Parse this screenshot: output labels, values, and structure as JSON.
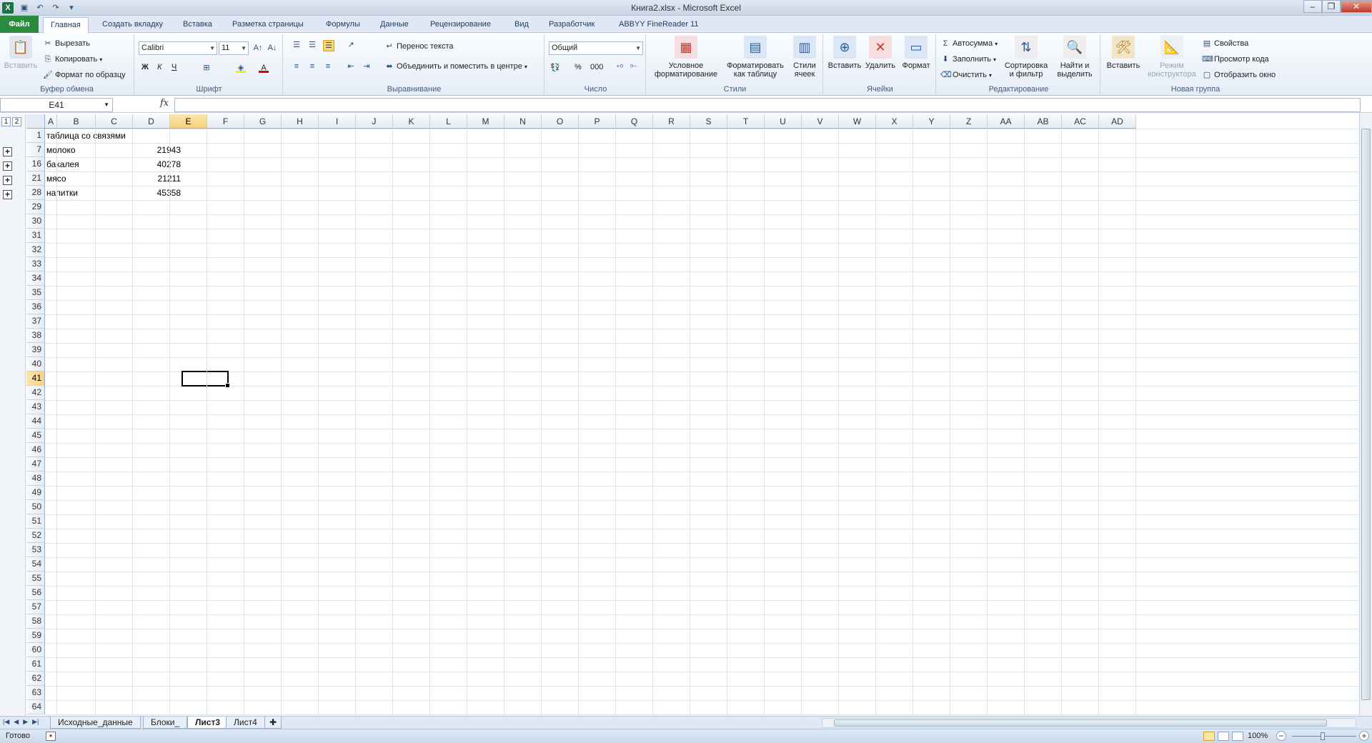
{
  "window": {
    "title": "Книга2.xlsx - Microsoft Excel",
    "app_icon": "X"
  },
  "tabs": [
    {
      "label": "Файл"
    },
    {
      "label": "Главная"
    },
    {
      "label": "Создать вкладку"
    },
    {
      "label": "Вставка"
    },
    {
      "label": "Разметка страницы"
    },
    {
      "label": "Формулы"
    },
    {
      "label": "Данные"
    },
    {
      "label": "Рецензирование"
    },
    {
      "label": "Вид"
    },
    {
      "label": "Разработчик"
    },
    {
      "label": "ABBYY FineReader 11"
    }
  ],
  "ribbon": {
    "clipboard": {
      "label": "Буфер обмена",
      "paste": "Вставить",
      "cut": "Вырезать",
      "copy": "Копировать",
      "format_painter": "Формат по образцу"
    },
    "font": {
      "label": "Шрифт",
      "name": "Calibri",
      "size": "11",
      "bold": "Ж",
      "italic": "К",
      "underline": "Ч"
    },
    "alignment": {
      "label": "Выравнивание",
      "wrap": "Перенос текста",
      "merge": "Объединить и поместить в центре"
    },
    "number": {
      "label": "Число",
      "format": "Общий",
      "percent": "%",
      "thousands": "000"
    },
    "styles": {
      "label": "Стили",
      "conditional": "Условное форматирование",
      "as_table": "Форматировать как таблицу",
      "cell_styles": "Стили ячеек"
    },
    "cells": {
      "label": "Ячейки",
      "insert": "Вставить",
      "delete": "Удалить",
      "format": "Формат"
    },
    "editing": {
      "label": "Редактирование",
      "autosum": "Автосумма",
      "fill": "Заполнить",
      "clear": "Очистить",
      "sort": "Сортировка и фильтр",
      "find": "Найти и выделить"
    },
    "newgroup": {
      "label": "Новая группа",
      "insert": "Вставить",
      "design_mode": "Режим конструктора",
      "properties": "Свойства",
      "view_code": "Просмотр кода",
      "show_window": "Отобразить окно"
    }
  },
  "formula_bar": {
    "name_box": "E41",
    "fx": "fx",
    "value": ""
  },
  "outline": {
    "levels": [
      "1",
      "2"
    ],
    "plus": "+"
  },
  "columns": [
    "A",
    "B",
    "C",
    "D",
    "E",
    "F",
    "G",
    "H",
    "I",
    "J",
    "K",
    "L",
    "M",
    "N",
    "O",
    "P",
    "Q",
    "R",
    "S",
    "T",
    "U",
    "V",
    "W",
    "X",
    "Y",
    "Z",
    "AA",
    "AB",
    "AC",
    "AD"
  ],
  "selected_column": "E",
  "rows": [
    "1",
    "7",
    "16",
    "21",
    "28",
    "29",
    "30",
    "31",
    "32",
    "33",
    "34",
    "35",
    "36",
    "37",
    "38",
    "39",
    "40",
    "41",
    "42",
    "43",
    "44",
    "45",
    "46",
    "47",
    "48",
    "49",
    "50",
    "51",
    "52",
    "53",
    "54",
    "55",
    "56",
    "57",
    "58",
    "59",
    "60",
    "61",
    "62",
    "63",
    "64"
  ],
  "selected_row": "41",
  "cells": {
    "a1": "таблица со связями",
    "a7": "молоко",
    "d7": "21943",
    "a16": "бакалея",
    "d16": "40278",
    "a21": "мясо",
    "d21": "21211",
    "a28": "напитки",
    "d28": "45358"
  },
  "sheets": [
    {
      "name": "Исходные_данные"
    },
    {
      "name": "Блоки_"
    },
    {
      "name": "Лист3"
    },
    {
      "name": "Лист4"
    }
  ],
  "status": {
    "ready": "Готово",
    "zoom": "100%",
    "minus": "−",
    "plus": "+"
  }
}
